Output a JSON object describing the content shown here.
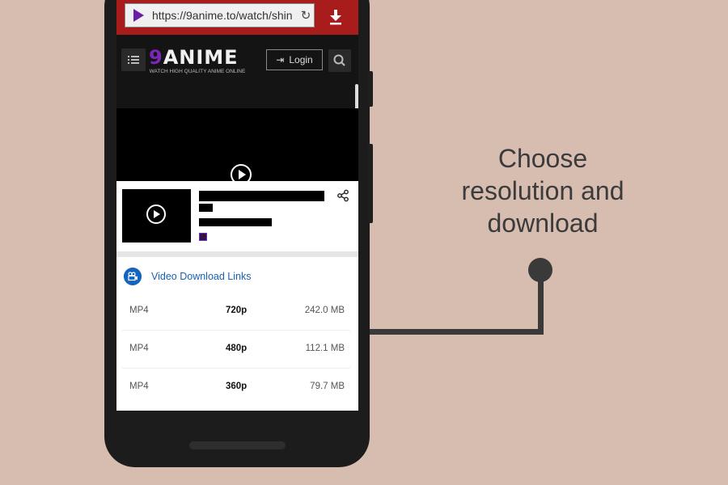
{
  "browser": {
    "url": "https://9anime.to/watch/shin",
    "reload_icon": "reload-icon",
    "download_icon": "download-icon"
  },
  "site": {
    "logo_number": "9",
    "logo_word": "ANIME",
    "logo_tagline": "WATCH HIGH QUALITY ANIME ONLINE",
    "login_label": "Login",
    "menu_icon": "menu-icon",
    "search_icon": "search-icon"
  },
  "links": {
    "title": "Video Download Links",
    "rows": [
      {
        "format": "MP4",
        "resolution": "720p",
        "size": "242.0 MB"
      },
      {
        "format": "MP4",
        "resolution": "480p",
        "size": "112.1 MB"
      },
      {
        "format": "MP4",
        "resolution": "360p",
        "size": "79.7 MB"
      }
    ]
  },
  "caption": {
    "line1": "Choose",
    "line2": "resolution and",
    "line3": "download"
  },
  "colors": {
    "background": "#d7bcb0",
    "browser_bar": "#a81c1c",
    "brand_purple": "#7a26b8",
    "link_blue": "#1a5fb4"
  }
}
